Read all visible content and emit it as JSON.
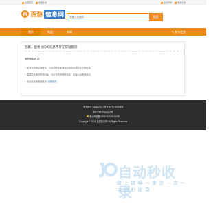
{
  "topbar": {
    "left": [
      {
        "icon": "home-icon",
        "label": "设置首页"
      },
      {
        "icon": "bookmark-icon",
        "label": "收藏此站"
      }
    ],
    "right": [
      {
        "icon": "user-icon",
        "label": "会员登录"
      },
      {
        "icon": "register-icon",
        "label": "免费注册"
      }
    ]
  },
  "header": {
    "logo_mark": "百",
    "logo_text1": "百游",
    "logo_text2": "信息网",
    "search_placeholder": "请输入关键词",
    "search_button": "搜索"
  },
  "nav": {
    "items": [
      "首页",
      "商品",
      "新闻"
    ],
    "right_label": "发布信息"
  },
  "notice": {
    "title": "抱歉，您要访问的信息不存在或被删除",
    "sub": "请您稍后再试：",
    "lines": [
      "如果您是网站管理员，可尝试联系客服在后台修改或恢复此条信息。",
      "如果您是网站的访问者，可以查看其他的信息，或者以后再来访问。",
      "点击此链接返回首页"
    ],
    "link_text": "返回首页"
  },
  "footer": {
    "links": "关于我们 | 帮助中心 | 联系我们 | 网站地图",
    "icp": "浙ICP备19032975号",
    "police": "浙公网安备33052902000193号",
    "copyright": "Copyright © 2021 百游信息网 All Rights Reserved"
  },
  "watermark": {
    "big": "自动秒收录",
    "small": "致 上 链 接 一 来 访 一 次 一 自 动 秒 收 录"
  },
  "colors": {
    "accent": "#f08a1a",
    "footer_bg": "#2d2d2d",
    "link": "#3a7ac4"
  }
}
